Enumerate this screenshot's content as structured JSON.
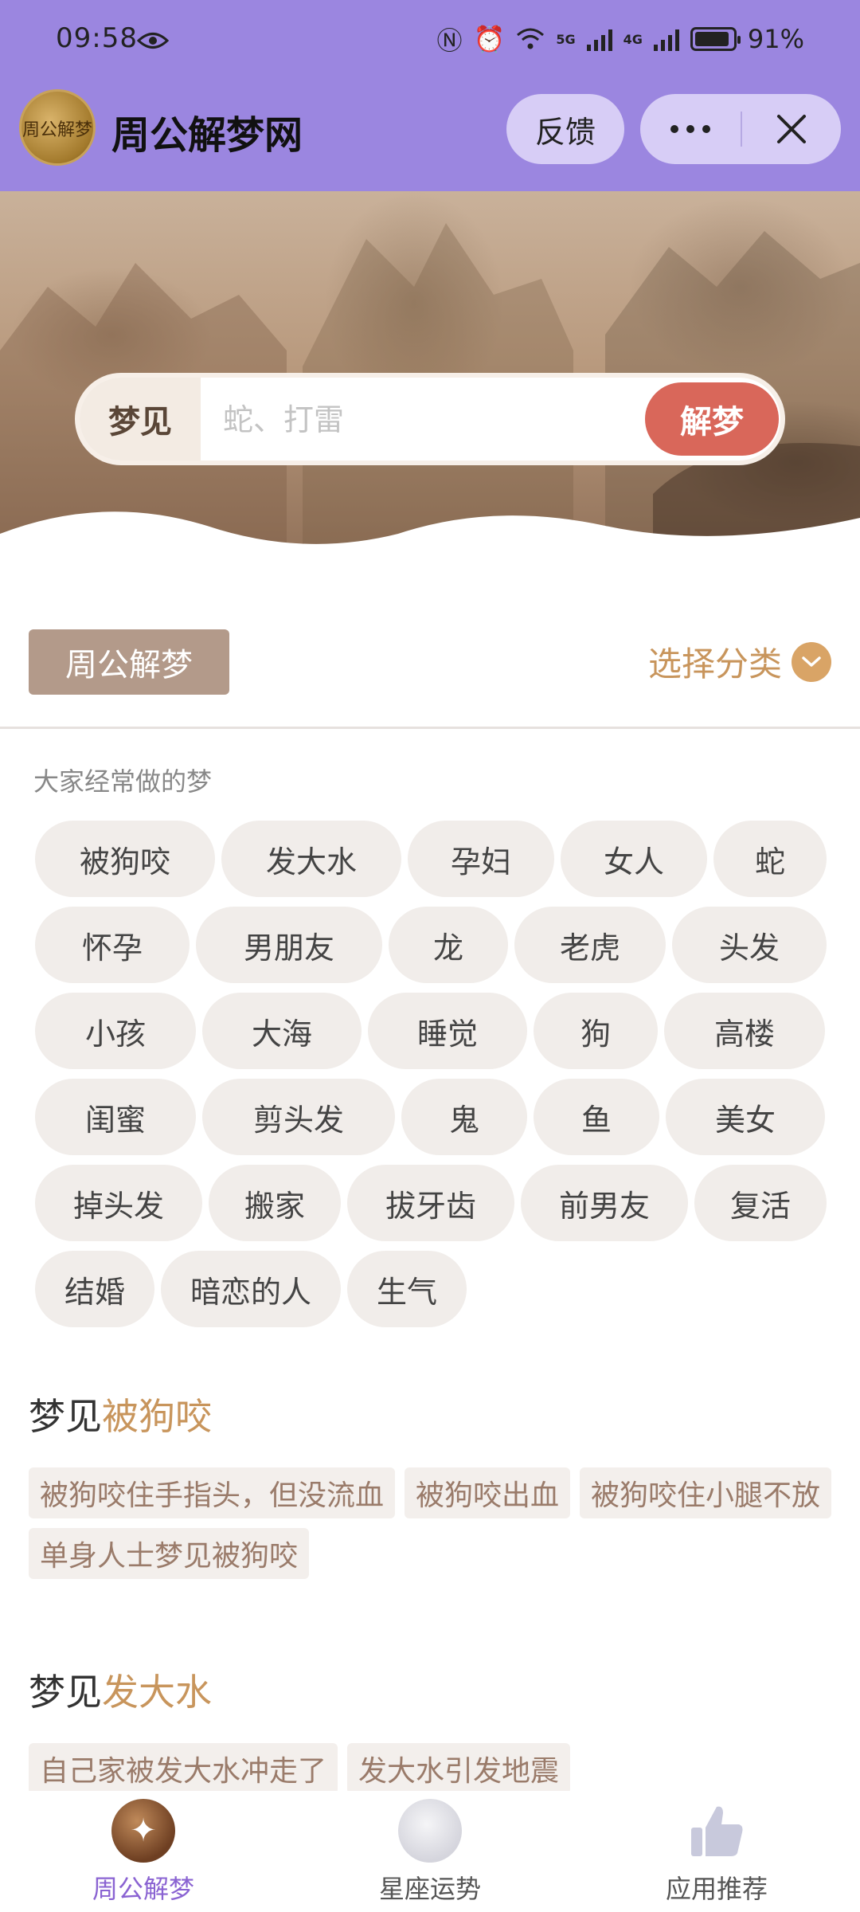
{
  "status": {
    "time": "09:58",
    "signal_5g": "5G",
    "signal_4g": "4G",
    "battery_percent": "91%",
    "battery_level": 0.91
  },
  "header": {
    "title": "周公解梦网",
    "logo_text": "周公解梦",
    "feedback_label": "反馈"
  },
  "search": {
    "label": "梦见",
    "placeholder": "蛇、打雷",
    "button_label": "解梦"
  },
  "category": {
    "tag": "周公解梦",
    "select_label": "选择分类"
  },
  "popular": {
    "heading": "大家经常做的梦",
    "rows": [
      [
        "被狗咬",
        "发大水",
        "孕妇",
        "女人",
        "蛇"
      ],
      [
        "怀孕",
        "男朋友",
        "龙",
        "老虎",
        "头发"
      ],
      [
        "小孩",
        "大海",
        "睡觉",
        "狗",
        "高楼"
      ],
      [
        "闺蜜",
        "剪头发",
        "鬼",
        "鱼",
        "美女"
      ],
      [
        "掉头发",
        "搬家",
        "拔牙齿",
        "前男友",
        "复活"
      ],
      [
        "结婚",
        "暗恋的人",
        "生气"
      ]
    ]
  },
  "dreams": [
    {
      "prefix": "梦见",
      "keyword": "被狗咬",
      "items": [
        "被狗咬住手指头，但没流血",
        "被狗咬出血",
        "被狗咬住小腿不放",
        "单身人士梦见被狗咬"
      ]
    },
    {
      "prefix": "梦见",
      "keyword": "发大水",
      "items": [
        "自己家被发大水冲走了",
        "发大水引发地震"
      ]
    }
  ],
  "tabs": [
    {
      "label": "周公解梦",
      "icon": "dream-icon",
      "active": true
    },
    {
      "label": "星座运势",
      "icon": "horoscope-icon",
      "active": false
    },
    {
      "label": "应用推荐",
      "icon": "thumbs-up-icon",
      "active": false
    }
  ],
  "colors": {
    "header_bg": "#9b86e0",
    "accent_gold": "#c8955c",
    "search_button": "#d9675a",
    "active_tab": "#8a63d2"
  }
}
